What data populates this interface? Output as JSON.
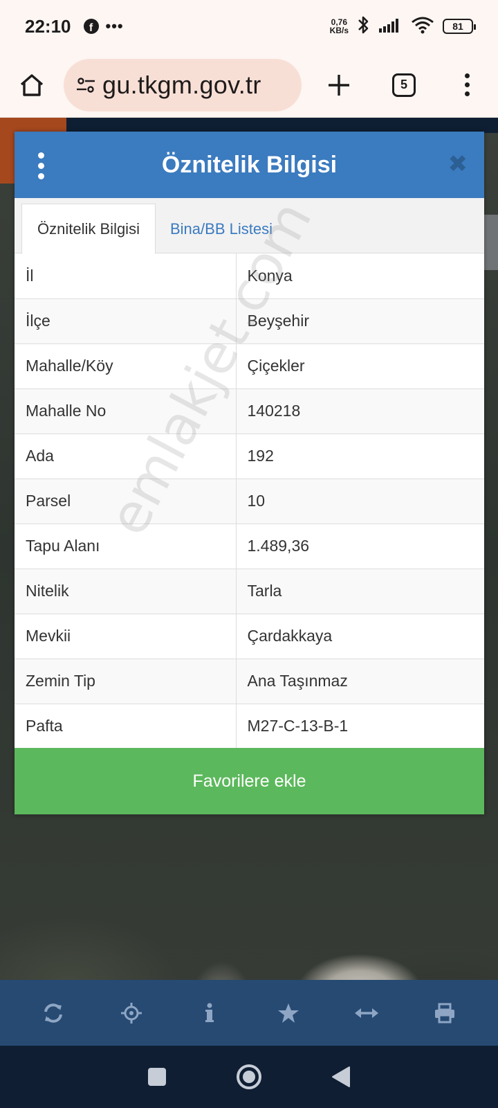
{
  "status_bar": {
    "time": "22:10",
    "net_speed_value": "0,76",
    "net_speed_unit": "KB/s",
    "battery": "81"
  },
  "browser": {
    "url": "gu.tkgm.gov.tr",
    "tab_count": "5"
  },
  "dialog": {
    "title": "Öznitelik Bilgisi",
    "close_glyph": "✖",
    "tabs": [
      {
        "label": "Öznitelik Bilgisi"
      },
      {
        "label": "Bina/BB Listesi"
      }
    ],
    "rows": [
      {
        "key": "İl",
        "value": "Konya"
      },
      {
        "key": "İlçe",
        "value": "Beyşehir"
      },
      {
        "key": "Mahalle/Köy",
        "value": "Çiçekler"
      },
      {
        "key": "Mahalle No",
        "value": "140218"
      },
      {
        "key": "Ada",
        "value": "192"
      },
      {
        "key": "Parsel",
        "value": "10"
      },
      {
        "key": "Tapu Alanı",
        "value": "1.489,36"
      },
      {
        "key": "Nitelik",
        "value": "Tarla"
      },
      {
        "key": "Mevkii",
        "value": "Çardakkaya"
      },
      {
        "key": "Zemin Tip",
        "value": "Ana Taşınmaz"
      },
      {
        "key": "Pafta",
        "value": "M27-C-13-B-1"
      }
    ],
    "favorite_button": "Favorilere ekle"
  },
  "watermark": "emlakjet.com",
  "toolbar": {
    "icons": [
      "refresh-icon",
      "locate-icon",
      "info-icon",
      "star-icon",
      "measure-icon",
      "print-icon"
    ]
  },
  "colors": {
    "header_blue": "#3b7bbf",
    "toolbar_blue": "#274a73",
    "button_green": "#5cb85c",
    "toolbar_icon": "#8ea6c4"
  }
}
